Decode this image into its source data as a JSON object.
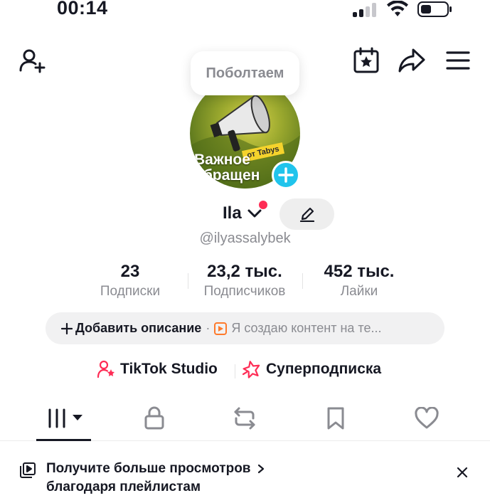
{
  "status_bar": {
    "time": "00:14"
  },
  "tooltip": {
    "text": "Поболтаем"
  },
  "avatar": {
    "overlay_title": "Важное\nобращен",
    "tag": "от Tabys"
  },
  "profile": {
    "name": "Ila",
    "username": "@ilyassalybek"
  },
  "stats": [
    {
      "value": "23",
      "label": "Подписки"
    },
    {
      "value": "23,2 тыс.",
      "label": "Подписчиков"
    },
    {
      "value": "452 тыс.",
      "label": "Лайки"
    }
  ],
  "bio": {
    "add_label": "Добавить описание",
    "separator": "·",
    "preview": "Я создаю контент на те..."
  },
  "links": {
    "studio": "TikTok Studio",
    "subscription": "Суперподписка"
  },
  "banner": {
    "line1": "Получите больше просмотров",
    "line2": "благодаря плейлистам"
  },
  "colors": {
    "accent_red": "#fe2c55",
    "add_blue": "#20c4ec",
    "muted": "#8a8b91",
    "text": "#161823"
  },
  "icons": [
    "add-friend-icon",
    "calendar-star-icon",
    "share-icon",
    "menu-icon",
    "pencil-icon",
    "grid-icon",
    "lock-icon",
    "repost-icon",
    "bookmark-icon",
    "heart-icon",
    "playlist-icon",
    "close-icon"
  ]
}
